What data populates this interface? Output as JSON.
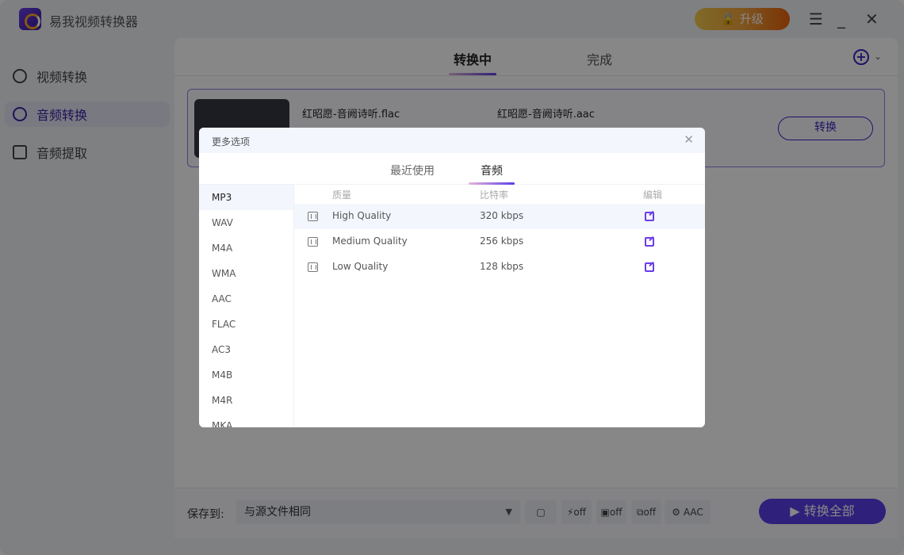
{
  "app": {
    "title": "易我视频转换器",
    "upgrade": "升级"
  },
  "sidebar": {
    "items": [
      {
        "label": "视频转换"
      },
      {
        "label": "音频转换"
      },
      {
        "label": "音频提取"
      }
    ]
  },
  "tabs": [
    {
      "label": "转换中"
    },
    {
      "label": "完成"
    }
  ],
  "file": {
    "source": "红昭愿-音阙诗听.flac",
    "target": "红昭愿-音阙诗听.aac",
    "convert": "转换"
  },
  "bottom": {
    "save_label": "保存到:",
    "save_value": "与源文件相同",
    "off": "off",
    "format": "AAC",
    "convert_all": "转换全部"
  },
  "modal": {
    "title": "更多选项",
    "tabs": [
      {
        "label": "最近使用"
      },
      {
        "label": "音频"
      }
    ],
    "formats": [
      "MP3",
      "WAV",
      "M4A",
      "WMA",
      "AAC",
      "FLAC",
      "AC3",
      "M4B",
      "M4R",
      "MKA"
    ],
    "headers": {
      "quality": "质量",
      "bitrate": "比特率",
      "edit": "编辑"
    },
    "rows": [
      {
        "quality": "High Quality",
        "bitrate": "320 kbps"
      },
      {
        "quality": "Medium Quality",
        "bitrate": "256 kbps"
      },
      {
        "quality": "Low Quality",
        "bitrate": "128 kbps"
      }
    ]
  }
}
